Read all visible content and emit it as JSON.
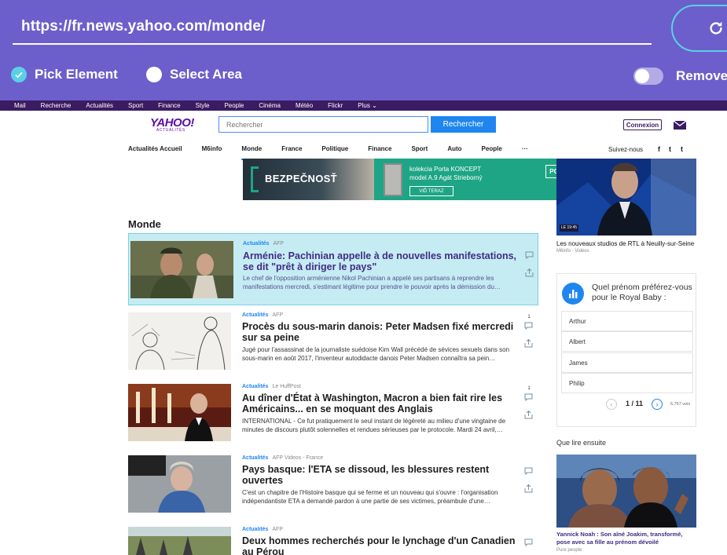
{
  "toolbar": {
    "url": "https://fr.news.yahoo.com/monde/",
    "pick_element_label": "Pick Element",
    "select_area_label": "Select Area",
    "remove_label": "Remove"
  },
  "top_nav": [
    "Mail",
    "Recherche",
    "Actualités",
    "Sport",
    "Finance",
    "Style",
    "People",
    "Cinéma",
    "Météo",
    "Flickr",
    "Plus ⌄"
  ],
  "header": {
    "logo": "YAHOO!",
    "logo_sub": "ACTUALITÉS",
    "search_placeholder": "Rechercher",
    "search_button": "Rechercher",
    "connexion": "Connexion"
  },
  "section_nav": [
    "Actualités Accueil",
    "M6info",
    "Monde",
    "France",
    "Politique",
    "Finance",
    "Sport",
    "Auto",
    "People",
    "···"
  ],
  "follow_label": "Suivez-nous",
  "social": [
    "f",
    "t",
    "t"
  ],
  "ad": {
    "left_text": "BEZPEČNOSŤ",
    "line1": "kolekcia Porta KONCEPT",
    "line2": "model A.9 Agát Strieborný",
    "cta": "VIĎ TERAZ",
    "brand": "PORTA"
  },
  "video": {
    "caption": "Les nouveaux studios de RTL à Neuilly-sur-Seine",
    "source": "M6info - Vidéos",
    "badge": "LE 19:45"
  },
  "section_title": "Monde",
  "articles": [
    {
      "category": "Actualités",
      "source": "AFP",
      "title": "Arménie: Pachinian appelle à de nouvelles manifestations, se dit \"prêt à diriger le pays\"",
      "summary": "Le chef de l'opposition arménienne Nikol Pachinian a appelé ses partisans à reprendre les manifestations mercredi, s'estimant légitime pour prendre le pouvoir après la démission du…",
      "comments": ""
    },
    {
      "category": "Actualités",
      "source": "AFP",
      "title": "Procès du sous-marin danois: Peter Madsen fixé mercredi sur sa peine",
      "summary": "Jugé pour l'assassinat de la journaliste suédoise Kim Wall précédé de sévices sexuels dans son sous-marin en août 2017, l'inventeur autodidacte danois Peter Madsen connaîtra sa pein…",
      "comments": "1"
    },
    {
      "category": "Actualités",
      "source": "Le HuffPost",
      "title": "Au dîner d'État à Washington, Macron a bien fait rire les Américains... en se moquant des Anglais",
      "summary": "INTERNATIONAL - Ce fut pratiquement le seul instant de légèreté au milieu d'une vingtaine de minutes de discours plutôt solennelles et rendues sérieuses par le protocole. Mardi 24 avril,…",
      "comments": "1"
    },
    {
      "category": "Actualités",
      "source": "AFP Videos - France",
      "title": "Pays basque: l'ETA se dissoud, les blessures restent ouvertes",
      "summary": "C'est un chapitre de l'Histoire basque qui se ferme et un nouveau qui s'ouvre : l'organisation indépendantiste ETA a demandé pardon à une partie de ses victimes, préambule d'une…",
      "comments": ""
    },
    {
      "category": "Actualités",
      "source": "AFP",
      "title": "Deux hommes recherchés pour le lynchage d'un Canadien au Pérou",
      "summary": "",
      "comments": ""
    }
  ],
  "poll": {
    "question": "Quel prénom préférez-vous pour le Royal Baby :",
    "options": [
      "Arthur",
      "Albert",
      "James",
      "Philip"
    ],
    "page": "1 / 11",
    "votes": "6,757 voix"
  },
  "read_next": {
    "title": "Que lire ensuite",
    "caption": "Yannick Noah : Son aîné Joakim, transformé, pose avec sa fille au prénom dévoilé",
    "source": "Pure people"
  }
}
